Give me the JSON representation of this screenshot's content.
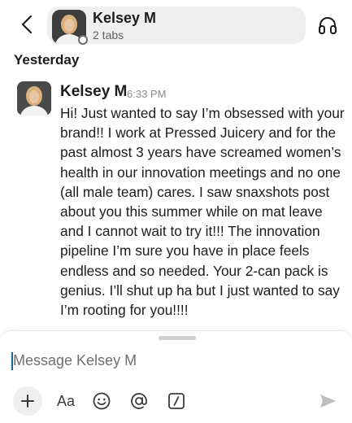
{
  "header": {
    "name": "Kelsey M",
    "subtitle": "2 tabs",
    "back_icon": "chevron-left-icon",
    "call_icon": "headphones-icon"
  },
  "day_divider": "Yesterday",
  "message": {
    "author": "Kelsey M",
    "time": "6:33 PM",
    "text": "Hi! Just wanted to say I’m obsessed with your brand!! I work at Pressed Juicery and for the past almost 3 years have screamed women’s health in our innovation meetings and no one (all male team) cares. I saw snaxshots post about you this summer while on mat leave and I cannot wait to try it!!! The innovation pipeline I’m sure you have in place feels endless and so needed. Your 2-can pack is genius. I’ll shut up ha but I just wanted to say I’m rooting for you!!!!"
  },
  "composer": {
    "placeholder": "Message Kelsey M",
    "value": "",
    "format_label": "Aa",
    "icons": [
      "plus-icon",
      "text-format-icon",
      "emoji-icon",
      "mention-icon",
      "slash-command-icon",
      "send-icon"
    ]
  },
  "colors": {
    "accent": "#1264a3",
    "text": "#1d1c1d",
    "muted": "#616061",
    "header_pill": "#efefef"
  }
}
